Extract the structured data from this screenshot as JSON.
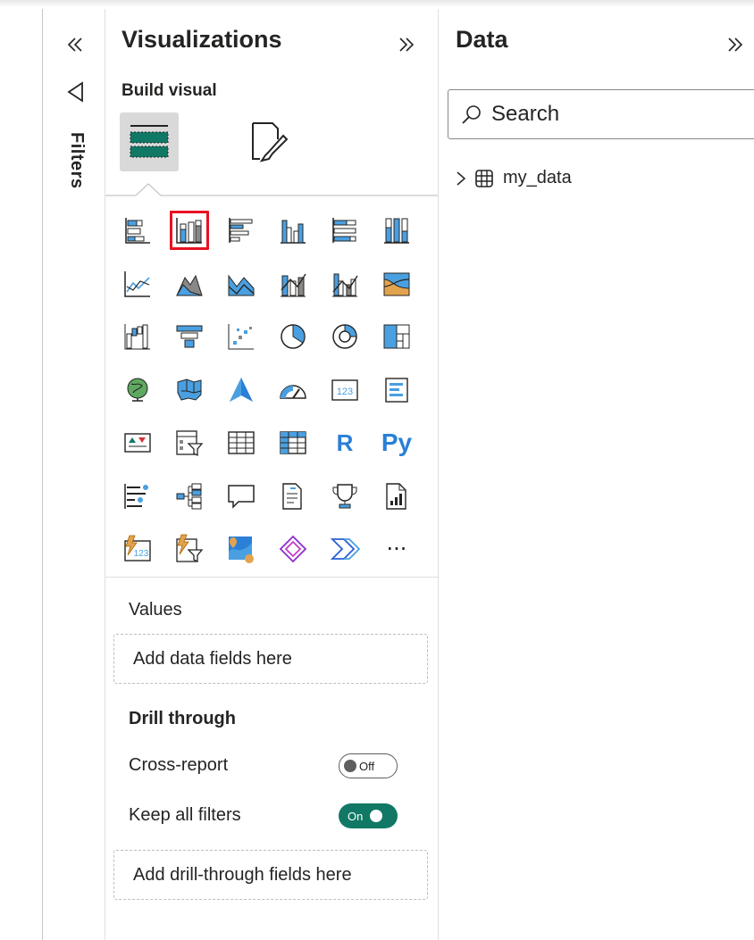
{
  "filters": {
    "label": "Filters"
  },
  "visualizations": {
    "title": "Visualizations",
    "build_visual": "Build visual",
    "icons": [
      "stacked-bar-chart-icon",
      "stacked-column-chart-icon",
      "clustered-bar-chart-icon",
      "clustered-column-chart-icon",
      "100-stacked-bar-chart-icon",
      "100-stacked-column-chart-icon",
      "line-chart-icon",
      "area-chart-icon",
      "stacked-area-chart-icon",
      "line-stacked-column-chart-icon",
      "line-clustered-column-chart-icon",
      "ribbon-chart-icon",
      "waterfall-chart-icon",
      "funnel-chart-icon",
      "scatter-chart-icon",
      "pie-chart-icon",
      "donut-chart-icon",
      "treemap-icon",
      "map-icon",
      "filled-map-icon",
      "azure-map-icon",
      "gauge-icon",
      "card-icon",
      "multi-row-card-icon",
      "kpi-icon",
      "slicer-icon",
      "table-icon",
      "matrix-icon",
      "r-visual-icon",
      "python-visual-icon",
      "key-influencers-icon",
      "decomposition-tree-icon",
      "qa-icon",
      "smart-narrative-icon",
      "metrics-icon",
      "paginated-report-icon",
      "power-apps-card-icon",
      "power-apps-slicer-icon",
      "arcgis-map-icon",
      "power-apps-icon",
      "power-automate-icon",
      "more-visuals-icon"
    ],
    "r_label": "R",
    "py_label": "Py",
    "card_label": "123",
    "more_label": "···",
    "values_label": "Values",
    "values_placeholder": "Add data fields here",
    "drill_through_label": "Drill through",
    "cross_report_label": "Cross-report",
    "cross_report_state": "Off",
    "keep_filters_label": "Keep all filters",
    "keep_filters_state": "On",
    "drill_placeholder": "Add drill-through fields here"
  },
  "data": {
    "title": "Data",
    "search_placeholder": "Search",
    "tables": [
      "my_data"
    ]
  },
  "colors": {
    "accent_teal": "#117865",
    "icon_blue": "#4a9fe0",
    "selected_red": "#e81123"
  }
}
